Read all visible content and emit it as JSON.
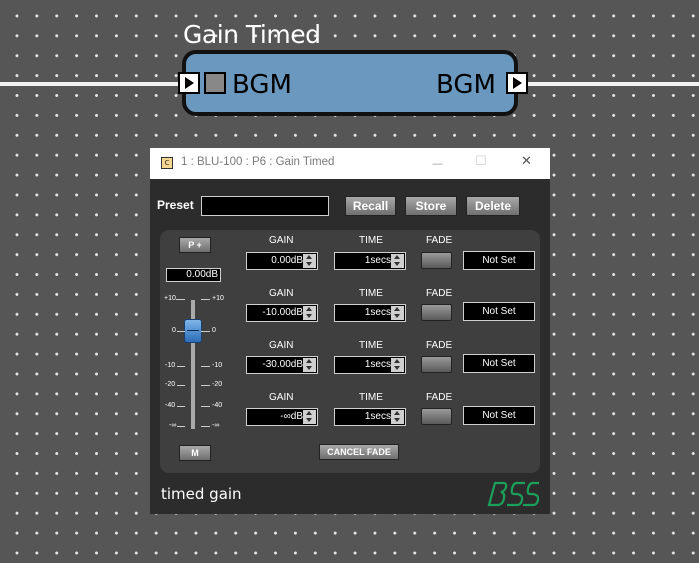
{
  "block": {
    "title": "Gain Timed",
    "input_label": "BGM",
    "output_label": "BGM"
  },
  "window": {
    "title": "1 : BLU-100 : P6 : Gain Timed",
    "icon": "app-icon",
    "minimize_glyph": "—",
    "maximize_glyph": "☐",
    "close_glyph": "✕"
  },
  "preset": {
    "label": "Preset",
    "value": "",
    "recall_label": "Recall",
    "store_label": "Store",
    "delete_label": "Delete"
  },
  "master": {
    "pplus_label": "P +",
    "gain_readout": "0.00dB",
    "mute_label": "M",
    "fader_value_db": 0,
    "scale": [
      "+10",
      "0",
      "-10",
      "-20",
      "-40",
      "-∞"
    ]
  },
  "rows": [
    {
      "gain_label": "GAIN",
      "gain_value": "0.00dB",
      "time_label": "TIME",
      "time_value": "1secs",
      "fade_label": "FADE",
      "status": "Not Set"
    },
    {
      "gain_label": "GAIN",
      "gain_value": "-10.00dB",
      "time_label": "TIME",
      "time_value": "1secs",
      "fade_label": "FADE",
      "status": "Not Set"
    },
    {
      "gain_label": "GAIN",
      "gain_value": "-30.00dB",
      "time_label": "TIME",
      "time_value": "1secs",
      "fade_label": "FADE",
      "status": "Not Set"
    },
    {
      "gain_label": "GAIN",
      "gain_value": "-∞dB",
      "time_label": "TIME",
      "time_value": "1secs",
      "fade_label": "FADE",
      "status": "Not Set"
    }
  ],
  "cancel_fade_label": "CANCEL FADE",
  "footer": {
    "label": "timed gain",
    "logo": "bss-logo"
  },
  "colors": {
    "canvas_bg": "#565656",
    "block_fill": "#6a98be",
    "window_bg": "#2c2c2c",
    "panel_bg": "#3f3f3f",
    "fader_thumb": "#3b7fd0",
    "logo_green": "#1aa05a"
  }
}
